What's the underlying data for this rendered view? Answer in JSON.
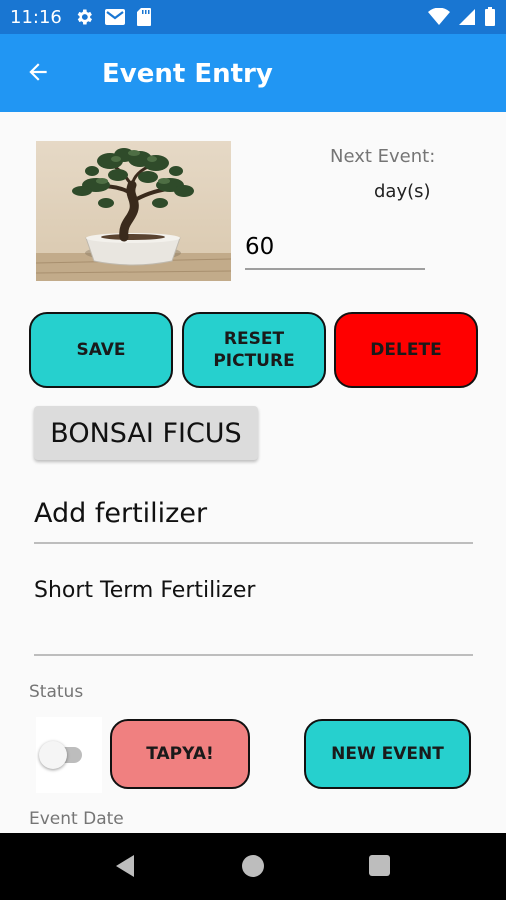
{
  "status_bar": {
    "time": "11:16",
    "left_icons": [
      "gear-icon",
      "gmail-icon",
      "sd-card-icon"
    ],
    "right_icons": [
      "wifi-icon",
      "signal-icon",
      "battery-icon"
    ]
  },
  "app_bar": {
    "title": "Event Entry",
    "back_icon": "arrow-left-icon",
    "color": "#2196f3"
  },
  "event": {
    "photo_subject": "bonsai-ficus-photo",
    "next_event_label": "Next Event:",
    "days_unit_label": "day(s)",
    "days_value": "60",
    "plant_name": "BONSAI FICUS",
    "title": "Add fertilizer",
    "description": "Short Term Fertilizer",
    "status_label": "Status",
    "status_on": false,
    "event_date_label": "Event Date"
  },
  "buttons": {
    "save": "SAVE",
    "reset_picture": "RESET\nPICTURE",
    "delete": "DELETE",
    "tapya": "TAPYA!",
    "new_event": "NEW EVENT"
  },
  "colors": {
    "accent_teal": "#26d0ce",
    "delete_red": "#ff0000",
    "tapya_pink": "#f08080",
    "status_bar": "#1976d2"
  },
  "nav_bar": {
    "icons": [
      "back-triangle-icon",
      "home-circle-icon",
      "recents-square-icon"
    ]
  }
}
